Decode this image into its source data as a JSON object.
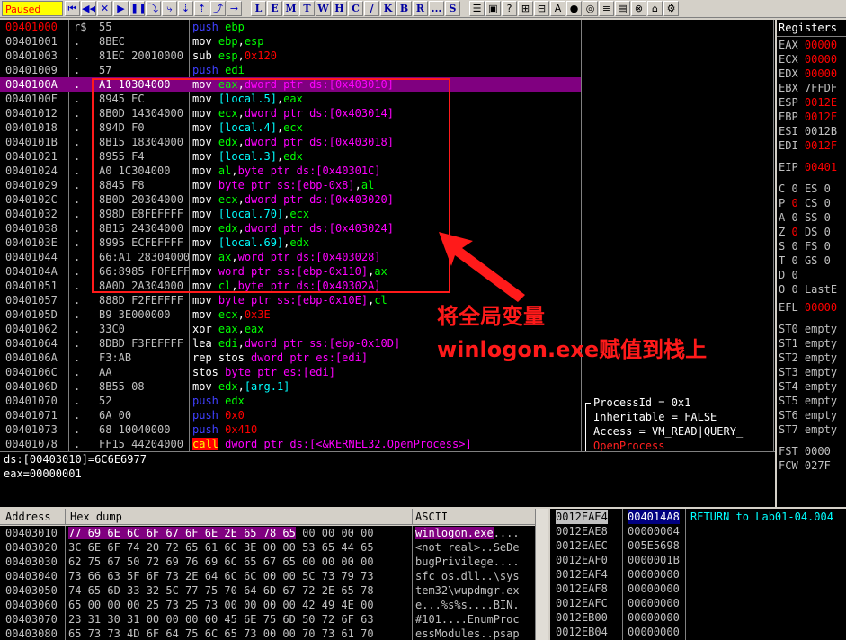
{
  "status": "Paused",
  "toolbar": {
    "buttons": [
      "⏮",
      "◀◀",
      "✕",
      "▶",
      "❚❚",
      "⤵",
      "⤷",
      "⇣",
      "⇡",
      "⤴",
      "→"
    ],
    "letters": [
      "L",
      "E",
      "M",
      "T",
      "W",
      "H",
      "C",
      "/",
      "K",
      "B",
      "R",
      "...",
      "S"
    ],
    "right": [
      "☰",
      "▣",
      "?",
      "⊞",
      "⊟",
      "A",
      "●",
      "◎",
      "≡",
      "▤",
      "⊗",
      "⌂",
      "⚙"
    ]
  },
  "disasm": [
    {
      "addr": "00401000",
      "mark": "r$",
      "hex": "55",
      "ins": [
        [
          "m-push",
          "push "
        ],
        [
          "tk-reg",
          "ebp"
        ]
      ]
    },
    {
      "addr": "00401001",
      "mark": ".",
      "hex": "8BEC",
      "ins": [
        [
          "m-mov",
          "mov "
        ],
        [
          "tk-reg",
          "ebp"
        ],
        [
          "m-mov",
          ","
        ],
        [
          "tk-reg",
          "esp"
        ]
      ]
    },
    {
      "addr": "00401003",
      "mark": ".",
      "hex": "81EC 20010000",
      "ins": [
        [
          "m-mov",
          "sub "
        ],
        [
          "tk-reg",
          "esp"
        ],
        [
          "m-mov",
          ","
        ],
        [
          "tk-num",
          "0x120"
        ]
      ]
    },
    {
      "addr": "00401009",
      "mark": ".",
      "hex": "57",
      "ins": [
        [
          "m-push",
          "push "
        ],
        [
          "tk-reg",
          "edi"
        ]
      ]
    },
    {
      "addr": "0040100A",
      "mark": ".",
      "hex": "A1 10304000",
      "ins": [
        [
          "m-mov",
          "mov "
        ],
        [
          "tk-reg",
          "eax"
        ],
        [
          "m-mov",
          ","
        ],
        [
          "tk-mem",
          "dword ptr ds:[0x403010]"
        ]
      ]
    },
    {
      "addr": "0040100F",
      "mark": ".",
      "hex": "8945 EC",
      "ins": [
        [
          "m-mov",
          "mov "
        ],
        [
          "tk-txt",
          "[local.5]"
        ],
        [
          "m-mov",
          ","
        ],
        [
          "tk-reg",
          "eax"
        ]
      ]
    },
    {
      "addr": "00401012",
      "mark": ".",
      "hex": "8B0D 14304000",
      "ins": [
        [
          "m-mov",
          "mov "
        ],
        [
          "tk-reg",
          "ecx"
        ],
        [
          "m-mov",
          ","
        ],
        [
          "tk-mem",
          "dword ptr ds:[0x403014]"
        ]
      ]
    },
    {
      "addr": "00401018",
      "mark": ".",
      "hex": "894D F0",
      "ins": [
        [
          "m-mov",
          "mov "
        ],
        [
          "tk-txt",
          "[local.4]"
        ],
        [
          "m-mov",
          ","
        ],
        [
          "tk-reg",
          "ecx"
        ]
      ]
    },
    {
      "addr": "0040101B",
      "mark": ".",
      "hex": "8B15 18304000",
      "ins": [
        [
          "m-mov",
          "mov "
        ],
        [
          "tk-reg",
          "edx"
        ],
        [
          "m-mov",
          ","
        ],
        [
          "tk-mem",
          "dword ptr ds:[0x403018]"
        ]
      ]
    },
    {
      "addr": "00401021",
      "mark": ".",
      "hex": "8955 F4",
      "ins": [
        [
          "m-mov",
          "mov "
        ],
        [
          "tk-txt",
          "[local.3]"
        ],
        [
          "m-mov",
          ","
        ],
        [
          "tk-reg",
          "edx"
        ]
      ]
    },
    {
      "addr": "00401024",
      "mark": ".",
      "hex": "A0 1C304000",
      "ins": [
        [
          "m-mov",
          "mov "
        ],
        [
          "tk-reg",
          "al"
        ],
        [
          "m-mov",
          ","
        ],
        [
          "tk-mem",
          "byte ptr ds:[0x40301C]"
        ]
      ]
    },
    {
      "addr": "00401029",
      "mark": ".",
      "hex": "8845 F8",
      "ins": [
        [
          "m-mov",
          "mov "
        ],
        [
          "tk-mem",
          "byte ptr ss:[ebp-0x8]"
        ],
        [
          "m-mov",
          ","
        ],
        [
          "tk-reg",
          "al"
        ]
      ]
    },
    {
      "addr": "0040102C",
      "mark": ".",
      "hex": "8B0D 20304000",
      "ins": [
        [
          "m-mov",
          "mov "
        ],
        [
          "tk-reg",
          "ecx"
        ],
        [
          "m-mov",
          ","
        ],
        [
          "tk-mem",
          "dword ptr ds:[0x403020]"
        ]
      ]
    },
    {
      "addr": "00401032",
      "mark": ".",
      "hex": "898D E8FEFFFF",
      "ins": [
        [
          "m-mov",
          "mov "
        ],
        [
          "tk-txt",
          "[local.70]"
        ],
        [
          "m-mov",
          ","
        ],
        [
          "tk-reg",
          "ecx"
        ]
      ]
    },
    {
      "addr": "00401038",
      "mark": ".",
      "hex": "8B15 24304000",
      "ins": [
        [
          "m-mov",
          "mov "
        ],
        [
          "tk-reg",
          "edx"
        ],
        [
          "m-mov",
          ","
        ],
        [
          "tk-mem",
          "dword ptr ds:[0x403024]"
        ]
      ]
    },
    {
      "addr": "0040103E",
      "mark": ".",
      "hex": "8995 ECFEFFFF",
      "ins": [
        [
          "m-mov",
          "mov "
        ],
        [
          "tk-txt",
          "[local.69]"
        ],
        [
          "m-mov",
          ","
        ],
        [
          "tk-reg",
          "edx"
        ]
      ]
    },
    {
      "addr": "00401044",
      "mark": ".",
      "hex": "66:A1 28304000",
      "ins": [
        [
          "m-mov",
          "mov "
        ],
        [
          "tk-reg",
          "ax"
        ],
        [
          "m-mov",
          ","
        ],
        [
          "tk-mem",
          "word ptr ds:[0x403028]"
        ]
      ]
    },
    {
      "addr": "0040104A",
      "mark": ".",
      "hex": "66:8985 F0FEFFFF",
      "ins": [
        [
          "m-mov",
          "mov "
        ],
        [
          "tk-mem",
          "word ptr ss:[ebp-0x110]"
        ],
        [
          "m-mov",
          ","
        ],
        [
          "tk-reg",
          "ax"
        ]
      ]
    },
    {
      "addr": "00401051",
      "mark": ".",
      "hex": "8A0D 2A304000",
      "ins": [
        [
          "m-mov",
          "mov "
        ],
        [
          "tk-reg",
          "cl"
        ],
        [
          "m-mov",
          ","
        ],
        [
          "tk-mem",
          "byte ptr ds:[0x40302A]"
        ]
      ]
    },
    {
      "addr": "00401057",
      "mark": ".",
      "hex": "888D F2FEFFFF",
      "ins": [
        [
          "m-mov",
          "mov "
        ],
        [
          "tk-mem",
          "byte ptr ss:[ebp-0x10E]"
        ],
        [
          "m-mov",
          ","
        ],
        [
          "tk-reg",
          "cl"
        ]
      ]
    },
    {
      "addr": "0040105D",
      "mark": ".",
      "hex": "B9 3E000000",
      "ins": [
        [
          "m-mov",
          "mov "
        ],
        [
          "tk-reg",
          "ecx"
        ],
        [
          "m-mov",
          ","
        ],
        [
          "tk-num",
          "0x3E"
        ]
      ]
    },
    {
      "addr": "00401062",
      "mark": ".",
      "hex": "33C0",
      "ins": [
        [
          "m-mov",
          "xor "
        ],
        [
          "tk-reg",
          "eax"
        ],
        [
          "m-mov",
          ","
        ],
        [
          "tk-reg",
          "eax"
        ]
      ]
    },
    {
      "addr": "00401064",
      "mark": ".",
      "hex": "8DBD F3FEFFFF",
      "ins": [
        [
          "m-mov",
          "lea "
        ],
        [
          "tk-reg",
          "edi"
        ],
        [
          "m-mov",
          ","
        ],
        [
          "tk-mem",
          "dword ptr ss:[ebp-0x10D]"
        ]
      ]
    },
    {
      "addr": "0040106A",
      "mark": ".",
      "hex": "F3:AB",
      "ins": [
        [
          "m-mov",
          "rep stos "
        ],
        [
          "tk-mem",
          "dword ptr es:[edi]"
        ]
      ]
    },
    {
      "addr": "0040106C",
      "mark": ".",
      "hex": "AA",
      "ins": [
        [
          "m-mov",
          "stos "
        ],
        [
          "tk-mem",
          "byte ptr es:[edi]"
        ]
      ]
    },
    {
      "addr": "0040106D",
      "mark": ".",
      "hex": "8B55 08",
      "ins": [
        [
          "m-mov",
          "mov "
        ],
        [
          "tk-reg",
          "edx"
        ],
        [
          "m-mov",
          ","
        ],
        [
          "tk-txt",
          "[arg.1]"
        ]
      ]
    },
    {
      "addr": "00401070",
      "mark": ".",
      "hex": "52",
      "ins": [
        [
          "m-push",
          "push "
        ],
        [
          "tk-reg",
          "edx"
        ]
      ]
    },
    {
      "addr": "00401071",
      "mark": ".",
      "hex": "6A 00",
      "ins": [
        [
          "m-push",
          "push "
        ],
        [
          "tk-num",
          "0x0"
        ]
      ]
    },
    {
      "addr": "00401073",
      "mark": ".",
      "hex": "68 10040000",
      "ins": [
        [
          "m-push",
          "push "
        ],
        [
          "tk-num",
          "0x410"
        ]
      ]
    },
    {
      "addr": "00401078",
      "mark": ".",
      "hex": "FF15 44204000",
      "ins": [
        [
          "m-call",
          "call"
        ],
        [
          "tk-mem",
          " dword ptr ds:[<&KERNEL32.OpenProcess>]"
        ]
      ]
    }
  ],
  "comments": [
    "ProcessId = 0x1",
    "Inheritable = FALSE",
    "Access = VM_READ|QUERY_",
    "OpenProcess"
  ],
  "annotation": {
    "line1": "将全局变量",
    "line2": "winlogon.exe赋值到栈上"
  },
  "info": [
    "ds:[00403010]=6C6E6977",
    "eax=00000001"
  ],
  "registers": {
    "title": "Registers",
    "gp": [
      [
        "EAX",
        "00000"
      ],
      [
        "ECX",
        "00000"
      ],
      [
        "EDX",
        "00000"
      ],
      [
        "EBX",
        "7FFDF"
      ],
      [
        "ESP",
        "0012E"
      ],
      [
        "EBP",
        "0012F"
      ],
      [
        "ESI",
        "0012B"
      ],
      [
        "EDI",
        "0012F"
      ]
    ],
    "eip": [
      "EIP",
      "00401"
    ],
    "flags": [
      [
        "C",
        "0",
        "ES",
        "0"
      ],
      [
        "P",
        "0",
        "CS",
        "0"
      ],
      [
        "A",
        "0",
        "SS",
        "0"
      ],
      [
        "Z",
        "0",
        "DS",
        "0"
      ],
      [
        "S",
        "0",
        "FS",
        "0"
      ],
      [
        "T",
        "0",
        "GS",
        "0"
      ],
      [
        "D",
        "0",
        "",
        ""
      ],
      [
        "O",
        "0",
        "LastE",
        ""
      ]
    ],
    "efl": [
      "EFL",
      "00000"
    ],
    "st": [
      [
        "ST0",
        "empty"
      ],
      [
        "ST1",
        "empty"
      ],
      [
        "ST2",
        "empty"
      ],
      [
        "ST3",
        "empty"
      ],
      [
        "ST4",
        "empty"
      ],
      [
        "ST5",
        "empty"
      ],
      [
        "ST6",
        "empty"
      ],
      [
        "ST7",
        "empty"
      ]
    ],
    "fst": [
      "FST",
      "0000"
    ],
    "fcw": [
      "FCW",
      "027F"
    ]
  },
  "dump": {
    "headers": [
      "Address",
      "Hex dump",
      "ASCII"
    ],
    "rows": [
      {
        "addr": "00403010",
        "hexhl": "77 69 6E 6C 6F 67 6F 6E 2E 65 78 65",
        "hex": " 00 00 00 00",
        "asciihl": "winlogon.exe",
        "ascii": "...."
      },
      {
        "addr": "00403020",
        "hexhl": "",
        "hex": "3C 6E 6F 74 20 72 65 61 6C 3E 00 00 53 65 44 65",
        "asciihl": "",
        "ascii": "<not real>..SeDe"
      },
      {
        "addr": "00403030",
        "hexhl": "",
        "hex": "62 75 67 50 72 69 76 69 6C 65 67 65 00 00 00 00",
        "asciihl": "",
        "ascii": "bugPrivilege...."
      },
      {
        "addr": "00403040",
        "hexhl": "",
        "hex": "73 66 63 5F 6F 73 2E 64 6C 6C 00 00 5C 73 79 73",
        "asciihl": "",
        "ascii": "sfc_os.dll..\\sys"
      },
      {
        "addr": "00403050",
        "hexhl": "",
        "hex": "74 65 6D 33 32 5C 77 75 70 64 6D 67 72 2E 65 78",
        "asciihl": "",
        "ascii": "tem32\\wupdmgr.ex"
      },
      {
        "addr": "00403060",
        "hexhl": "",
        "hex": "65 00 00 00 25 73 25 73 00 00 00 00 42 49 4E 00",
        "asciihl": "",
        "ascii": "e...%s%s....BIN."
      },
      {
        "addr": "00403070",
        "hexhl": "",
        "hex": "23 31 30 31 00 00 00 00 45 6E 75 6D 50 72 6F 63",
        "asciihl": "",
        "ascii": "#101....EnumProc"
      },
      {
        "addr": "00403080",
        "hexhl": "",
        "hex": "65 73 73 4D 6F 64 75 6C 65 73 00 00 70 73 61 70",
        "asciihl": "",
        "ascii": "essModules..psap"
      }
    ]
  },
  "stack": [
    {
      "addr": "0012EAE4",
      "val": "004014A8",
      "comment": "RETURN to Lab01-04.004"
    },
    {
      "addr": "0012EAE8",
      "val": "00000004",
      "comment": ""
    },
    {
      "addr": "0012EAEC",
      "val": "005E5698",
      "comment": ""
    },
    {
      "addr": "0012EAF0",
      "val": "0000001B",
      "comment": ""
    },
    {
      "addr": "0012EAF4",
      "val": "00000000",
      "comment": ""
    },
    {
      "addr": "0012EAF8",
      "val": "00000000",
      "comment": ""
    },
    {
      "addr": "0012EAFC",
      "val": "00000000",
      "comment": ""
    },
    {
      "addr": "0012EB00",
      "val": "00000000",
      "comment": ""
    },
    {
      "addr": "0012EB04",
      "val": "00000000",
      "comment": ""
    }
  ]
}
